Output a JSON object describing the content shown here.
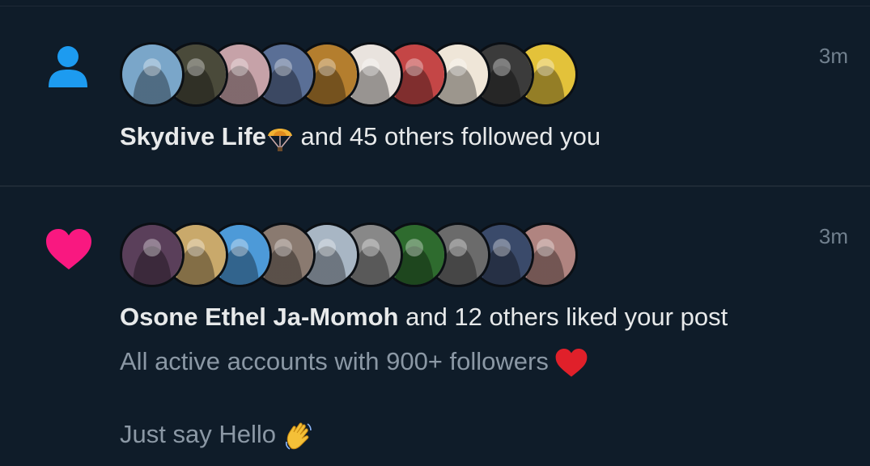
{
  "notifications": [
    {
      "type": "follow",
      "icon": "person-icon",
      "time": "3m",
      "actor": "Skydive Life",
      "actor_emoji": "parachute-emoji",
      "rest": " and 45 others followed you",
      "avatar_colors": [
        "#7aa6c9",
        "#4a4a3a",
        "#c6a2a8",
        "#5a6f96",
        "#b47e2e",
        "#e9e3de",
        "#c44646",
        "#efe6d8",
        "#3b3b3b",
        "#e3c23a"
      ]
    },
    {
      "type": "like",
      "icon": "heart-icon",
      "time": "3m",
      "actor": "Osone Ethel Ja-Momoh",
      "rest": " and 12 others liked your post",
      "snippet_line1": "All active accounts with 900+ followers",
      "snippet_line1_emoji": "red-heart-emoji",
      "snippet_line2": "Just say Hello",
      "snippet_line2_emoji": "waving-hand-emoji",
      "avatar_colors": [
        "#5a3f5a",
        "#c9a96b",
        "#4d9ad8",
        "#8a7a70",
        "#a8b6c4",
        "#888888",
        "#2e6b2e",
        "#6b6b6b",
        "#3a4a6a",
        "#b08480"
      ]
    }
  ],
  "colors": {
    "background": "#0f1c29",
    "follow_icon": "#1d9bf0",
    "like_icon": "#f91880",
    "secondary_text": "#8b98a5"
  }
}
